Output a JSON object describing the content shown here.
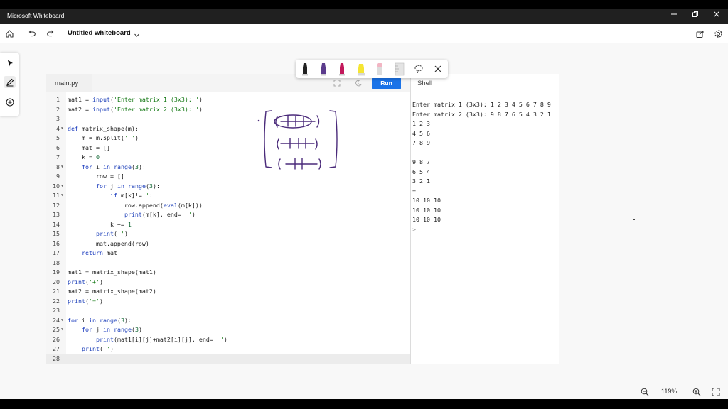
{
  "titlebar": {
    "app_title": "Microsoft Whiteboard"
  },
  "toolbar": {
    "doc_title": "Untitled whiteboard"
  },
  "editor": {
    "file_tab": "main.py",
    "run_label": "Run",
    "shell_tab": "Shell",
    "code_lines": [
      "mat1 = input('Enter matrix 1 (3x3): ')",
      "mat2 = input('Enter matrix 2 (3x3): ')",
      "",
      "def matrix_shape(m):",
      "    m = m.split(' ')",
      "    mat = []",
      "    k = 0",
      "    for i in range(3):",
      "        row = []",
      "        for j in range(3):",
      "            if m[k]!='':",
      "                row.append(eval(m[k]))",
      "                print(m[k], end=' ')",
      "            k += 1",
      "        print('')",
      "        mat.append(row)",
      "    return mat",
      "",
      "mat1 = matrix_shape(mat1)",
      "print('+')",
      "mat2 = matrix_shape(mat2)",
      "print('=')",
      "",
      "for i in range(3):",
      "    for j in range(3):",
      "        print(mat1[i][j]+mat2[i][j], end=' ')",
      "    print('')",
      ""
    ],
    "shell_lines": [
      "Enter matrix 1 (3x3): 1 2 3 4 5 6 7 8 9",
      "Enter matrix 2 (3x3): 9 8 7 6 5 4 3 2 1",
      "1 2 3",
      "4 5 6",
      "7 8 9",
      "+",
      "9 8 7",
      "6 5 4",
      "3 2 1",
      "=",
      "10 10 10",
      "10 10 10",
      "10 10 10"
    ],
    "shell_prompt": ">"
  },
  "zoom": {
    "level": "119%"
  },
  "colors": {
    "accent": "#1a73e8",
    "titlebar": "#202020",
    "ink": "#4a2a7a"
  },
  "icons": {
    "home": "home-icon",
    "undo": "undo-icon",
    "redo": "redo-icon",
    "share": "share-icon",
    "settings": "gear-icon",
    "select": "pointer-icon",
    "pen": "pen-icon",
    "add": "plus-circle-icon",
    "lasso": "lasso-icon",
    "close": "close-icon",
    "zoom_out": "zoom-out-icon",
    "zoom_in": "zoom-in-icon",
    "fullscreen": "fullscreen-icon"
  }
}
